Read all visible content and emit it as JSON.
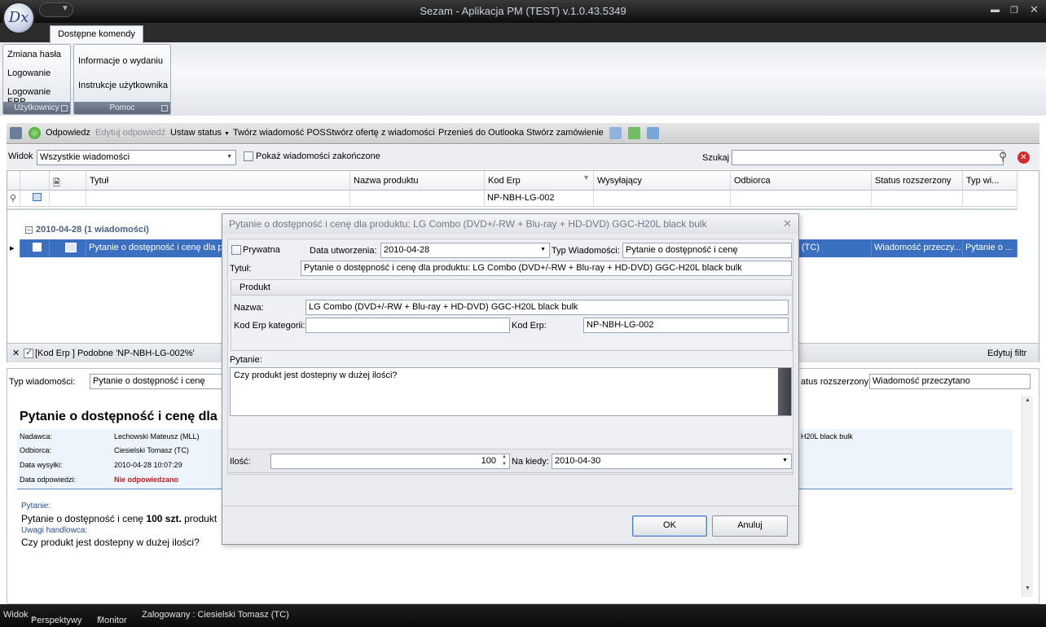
{
  "window": {
    "title": "Sezam - Aplikacja PM (TEST) v.1.0.43.5349",
    "logo": "Dx"
  },
  "ribbon": {
    "tab": "Dostępne komendy",
    "groups": [
      {
        "label": "Użytkownicy",
        "items": [
          "Zmiana hasła",
          "Logowanie",
          "Logowanie ERP"
        ]
      },
      {
        "label": "Pomoc",
        "items": [
          "Informacje o wydaniu",
          "Instrukcje użytkownika"
        ]
      }
    ]
  },
  "toolbar": {
    "reply": "Odpowiedz",
    "edit_reply": "Edytuj odpowiedź",
    "set_status": "Ustaw status",
    "create_pos": "Twórz wiadomość POS",
    "create_offer": "Stwórz ofertę z wiadomości",
    "move_outlook": "Przenieś do Outlooka",
    "create_order": "Stwórz zamówienie"
  },
  "view": {
    "label": "Widok",
    "value": "Wszystkie wiadomości",
    "show_finished": "Pokaż wiadomości zakończone",
    "search_label": "Szukaj",
    "search_value": ""
  },
  "grid": {
    "columns": [
      "Tytuł",
      "Nazwa produktu",
      "Kod Erp",
      "Wysyłający",
      "Odbiorca",
      "Status rozszerzony",
      "Typ wi..."
    ],
    "filter_kod_erp": "NP-NBH-LG-002",
    "group": "2010-04-28 (1 wiadomości)",
    "row": {
      "title": "Pytanie o dostępność i cenę dla pr",
      "recipient_suffix": "(TC)",
      "status": "Wiadomość przeczy...",
      "type": "Pytanie o ..."
    },
    "filter_text": "[Kod Erp ] Podobne 'NP-NBH-LG-002%'",
    "edit_filter": "Edytuj filtr"
  },
  "detail": {
    "type_label": "Typ wiadomości:",
    "type_value": "Pytanie o dostępność i cenę",
    "status_label": "atus rozszerzony:",
    "status_value": "Wiadomość przeczytano",
    "heading": "Pytanie o dostępność i cenę dla",
    "meta": [
      {
        "label": "Nadawca:",
        "value": "Lechowski Mateusz (MLL)"
      },
      {
        "label": "Odbiorca:",
        "value": "Ciesielski Tomasz (TC)"
      },
      {
        "label": "Data wysyłki:",
        "value": "2010-04-28 10:07:29"
      },
      {
        "label": "Data odpowiedzi:",
        "value": "Nie odpowiedzano"
      }
    ],
    "right_fragment": "H20L black bulk",
    "question_label": "Pytanie:",
    "question_prefix": "Pytanie o dostępność i cenę ",
    "question_qty": "100 szt.",
    "question_suffix": " produkt",
    "remarks_label": "Uwagi handlowca:",
    "remarks_text": "Czy produkt jest dostepny w dużej ilości?"
  },
  "statusbar": {
    "view": "Widok",
    "perspectives": "Perspektywy",
    "monitor": "Monitor",
    "logged": "Zalogowany : Ciesielski Tomasz (TC)"
  },
  "dialog": {
    "title": "Pytanie o dostępność i cenę dla produktu: LG Combo (DVD+/-RW  + Blu-ray + HD-DVD) GGC-H20L black bulk",
    "private_label": "Prywatna",
    "created_label": "Data utworzenia:",
    "created_value": "2010-04-28",
    "msg_type_label": "Typ Wiadomości:",
    "msg_type_value": "Pytanie o dostępność i cenę",
    "title_label": "Tytuł:",
    "title_value": "Pytanie o dostępność i cenę dla produktu: LG Combo (DVD+/-RW  + Blu-ray + HD-DVD) GGC-H20L black bulk",
    "product_section": "Produkt",
    "name_label": "Nazwa:",
    "name_value": "LG Combo (DVD+/-RW  + Blu-ray + HD-DVD) GGC-H20L black bulk",
    "cat_label": "Kod Erp kategorii:",
    "cat_value": "",
    "erp_label": "Kod Erp:",
    "erp_value": "NP-NBH-LG-002",
    "question_label": "Pytanie:",
    "question_value": "Czy produkt jest dostepny w dużej ilości?",
    "qty_label": "Ilość:",
    "qty_value": "100",
    "when_label": "Na kiedy:",
    "when_value": "2010-04-30",
    "ok": "OK",
    "cancel": "Anuluj"
  }
}
